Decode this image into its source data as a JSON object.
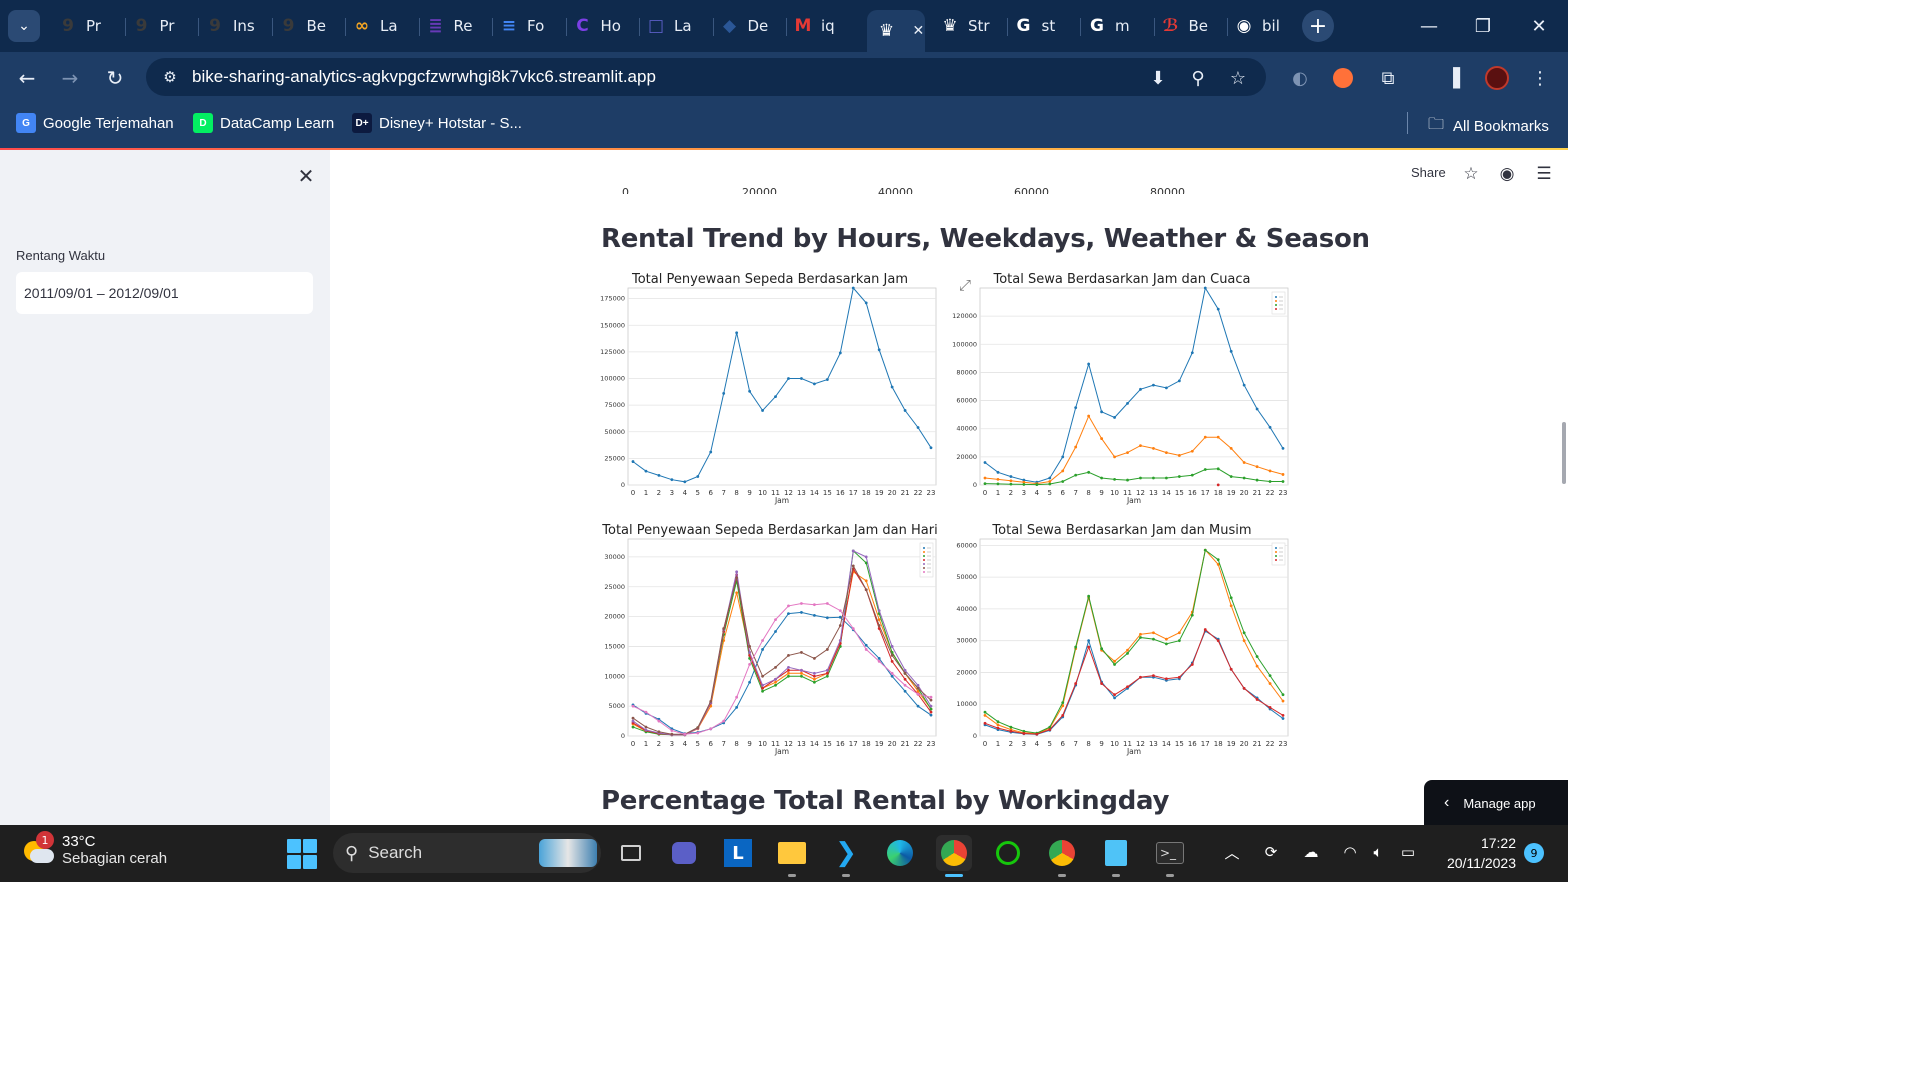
{
  "browser": {
    "tabs": [
      {
        "label": "Pr",
        "color": "#3a3a3a",
        "glyph": "9"
      },
      {
        "label": "Pr",
        "color": "#3a3a3a",
        "glyph": "9"
      },
      {
        "label": "Ins",
        "color": "#3a3a3a",
        "glyph": "9"
      },
      {
        "label": "Be",
        "color": "#3a3a3a",
        "glyph": "9"
      },
      {
        "label": "La",
        "color": "#f5a623",
        "glyph": "∞"
      },
      {
        "label": "Re",
        "color": "#673ab7",
        "glyph": "≣"
      },
      {
        "label": "Fo",
        "color": "#4285f4",
        "glyph": "≡"
      },
      {
        "label": "Ho",
        "color": "#7b3fe4",
        "glyph": "C"
      },
      {
        "label": "La",
        "color": "#5b5fc7",
        "glyph": "□"
      },
      {
        "label": "De",
        "color": "#2b5797",
        "glyph": "◆"
      },
      {
        "label": "iq",
        "color": "#e53935",
        "glyph": "M"
      },
      {
        "label": "",
        "color": "#ffffff",
        "glyph": "♛"
      },
      {
        "label": "Str",
        "color": "#ffffff",
        "glyph": "♛"
      },
      {
        "label": "st",
        "color": "#ffffff",
        "glyph": "G"
      },
      {
        "label": "m",
        "color": "#ffffff",
        "glyph": "G"
      },
      {
        "label": "Be",
        "color": "#e53935",
        "glyph": "ℬ"
      },
      {
        "label": "bil",
        "color": "#ffffff",
        "glyph": "◉"
      }
    ],
    "url": "bike-sharing-analytics-agkvpgcfzwrwhgi8k7vkc6.streamlit.app",
    "bookmarks": [
      {
        "label": "Google Terjemahan",
        "color": "#4285f4",
        "glyph": "G"
      },
      {
        "label": "DataCamp Learn",
        "color": "#03ef62",
        "glyph": "D"
      },
      {
        "label": "Disney+ Hotstar - S...",
        "color": "#0c1a3f",
        "glyph": "D+"
      }
    ],
    "all_bookmarks": "All Bookmarks"
  },
  "sidebar": {
    "range_label": "Rentang Waktu",
    "range_value": "2011/09/01 – 2012/09/01"
  },
  "header": {
    "share": "Share"
  },
  "prev_chart_ticks": [
    "0",
    "20000",
    "40000",
    "60000",
    "80000"
  ],
  "sections": {
    "trend_title": "Rental Trend by Hours, Weekdays, Weather & Season",
    "next_title": "Percentage Total Rental by Workingday"
  },
  "manage_app": "Manage app",
  "taskbar": {
    "temperature": "33°C",
    "weather": "Sebagian cerah",
    "weather_badge": "1",
    "search": "Search",
    "time": "17:22",
    "date": "20/11/2023",
    "notifications": "9"
  },
  "charts": {
    "hour": {
      "title": "Total Penyewaan Sepeda Berdasarkan Jam",
      "xlabel": "Jam"
    },
    "weather": {
      "title": "Total Sewa Berdasarkan Jam dan Cuaca",
      "xlabel": "Jam"
    },
    "weekday": {
      "title": "Total Penyewaan Sepeda Berdasarkan Jam dan Hari",
      "xlabel": "Jam"
    },
    "season": {
      "title": "Total Sewa Berdasarkan Jam dan Musim",
      "xlabel": "Jam"
    }
  },
  "chart_data": [
    {
      "id": "hour",
      "type": "line",
      "title": "Total Penyewaan Sepeda Berdasarkan Jam",
      "xlabel": "Jam",
      "ylabel": "",
      "x": [
        0,
        1,
        2,
        3,
        4,
        5,
        6,
        7,
        8,
        9,
        10,
        11,
        12,
        13,
        14,
        15,
        16,
        17,
        18,
        19,
        20,
        21,
        22,
        23
      ],
      "ylim": [
        0,
        185000
      ],
      "yticks": [
        0,
        25000,
        50000,
        75000,
        100000,
        125000,
        150000,
        175000
      ],
      "grid": true,
      "series": [
        {
          "color": "#1f77b4",
          "values": [
            22000,
            13000,
            9000,
            5000,
            3000,
            8000,
            31000,
            86000,
            143000,
            88000,
            70000,
            83000,
            100000,
            100000,
            95000,
            99000,
            124000,
            185000,
            171000,
            127000,
            92000,
            70000,
            54000,
            35000
          ]
        }
      ]
    },
    {
      "id": "weather",
      "type": "line",
      "title": "Total Sewa Berdasarkan Jam dan Cuaca",
      "xlabel": "Jam",
      "ylabel": "",
      "x": [
        0,
        1,
        2,
        3,
        4,
        5,
        6,
        7,
        8,
        9,
        10,
        11,
        12,
        13,
        14,
        15,
        16,
        17,
        18,
        19,
        20,
        21,
        22,
        23
      ],
      "ylim": [
        0,
        140000
      ],
      "yticks": [
        0,
        20000,
        40000,
        60000,
        80000,
        100000,
        120000
      ],
      "grid": true,
      "legend": "top-right",
      "series": [
        {
          "color": "#1f77b4",
          "values": [
            16000,
            9000,
            6000,
            3500,
            2000,
            5000,
            20000,
            55000,
            86000,
            52000,
            48000,
            58000,
            68000,
            71000,
            69000,
            74000,
            94000,
            140000,
            125000,
            95000,
            71000,
            54000,
            41000,
            26000
          ]
        },
        {
          "color": "#ff7f0e",
          "values": [
            5000,
            4000,
            3000,
            2000,
            1000,
            2500,
            10000,
            27000,
            49000,
            33000,
            20000,
            23000,
            28000,
            26000,
            23000,
            21000,
            24000,
            34000,
            34000,
            26000,
            16000,
            13000,
            10000,
            7500
          ]
        },
        {
          "color": "#2ca02c",
          "values": [
            1000,
            800,
            600,
            400,
            300,
            700,
            2500,
            7000,
            9000,
            5000,
            4000,
            3500,
            5000,
            5000,
            5000,
            6000,
            7000,
            11000,
            11500,
            6000,
            5000,
            3500,
            2500,
            2500
          ]
        },
        {
          "color": "#d62728",
          "values": [
            null,
            null,
            null,
            null,
            null,
            null,
            null,
            null,
            null,
            null,
            null,
            null,
            null,
            null,
            null,
            null,
            null,
            null,
            100,
            null,
            null,
            null,
            null,
            null
          ]
        }
      ]
    },
    {
      "id": "weekday",
      "type": "line",
      "title": "Total Penyewaan Sepeda Berdasarkan Jam dan Hari",
      "xlabel": "Jam",
      "ylabel": "",
      "x": [
        0,
        1,
        2,
        3,
        4,
        5,
        6,
        7,
        8,
        9,
        10,
        11,
        12,
        13,
        14,
        15,
        16,
        17,
        18,
        19,
        20,
        21,
        22,
        23
      ],
      "ylim": [
        0,
        33000
      ],
      "yticks": [
        0,
        5000,
        10000,
        15000,
        20000,
        25000,
        30000
      ],
      "grid": true,
      "legend": "top-right",
      "series": [
        {
          "color": "#1f77b4",
          "values": [
            5200,
            3800,
            2800,
            1200,
            400,
            600,
            1200,
            2200,
            4800,
            9000,
            14500,
            17500,
            20500,
            20700,
            20200,
            19800,
            19900,
            17800,
            15200,
            13000,
            10000,
            7500,
            5000,
            3500
          ]
        },
        {
          "color": "#ff7f0e",
          "values": [
            2000,
            800,
            400,
            200,
            200,
            1200,
            5000,
            16000,
            24000,
            14000,
            8000,
            9000,
            10500,
            10500,
            9500,
            10500,
            16000,
            27500,
            26000,
            19500,
            14000,
            10500,
            7500,
            4500
          ]
        },
        {
          "color": "#2ca02c",
          "values": [
            1500,
            700,
            300,
            200,
            200,
            1400,
            5500,
            17000,
            26000,
            13000,
            7500,
            8500,
            10000,
            10000,
            9000,
            10000,
            15000,
            31000,
            29000,
            20500,
            14000,
            10500,
            8000,
            4500
          ]
        },
        {
          "color": "#d62728",
          "values": [
            2200,
            900,
            400,
            200,
            200,
            1300,
            5500,
            17500,
            27000,
            13500,
            8000,
            9500,
            11000,
            11000,
            10000,
            10500,
            15500,
            28000,
            24500,
            18000,
            12500,
            9500,
            7000,
            4000
          ]
        },
        {
          "color": "#9467bd",
          "values": [
            2500,
            1000,
            500,
            200,
            200,
            1300,
            5600,
            17800,
            27500,
            14000,
            8500,
            9500,
            11500,
            11000,
            10500,
            11000,
            16000,
            31000,
            30000,
            21000,
            15000,
            11000,
            8500,
            5000
          ]
        },
        {
          "color": "#8c564b",
          "values": [
            3000,
            1500,
            700,
            300,
            300,
            1400,
            5800,
            18000,
            26500,
            15000,
            10000,
            11500,
            13500,
            14000,
            13000,
            14500,
            18500,
            28500,
            24500,
            18500,
            13500,
            10500,
            8000,
            6000
          ]
        },
        {
          "color": "#e377c2",
          "values": [
            5000,
            4000,
            2500,
            900,
            300,
            500,
            1200,
            2500,
            6500,
            12000,
            16000,
            19500,
            21800,
            22200,
            22000,
            22200,
            21000,
            18000,
            14500,
            12500,
            10500,
            8500,
            7000,
            6500
          ]
        }
      ]
    },
    {
      "id": "season",
      "type": "line",
      "title": "Total Sewa Berdasarkan Jam dan Musim",
      "xlabel": "Jam",
      "ylabel": "",
      "x": [
        0,
        1,
        2,
        3,
        4,
        5,
        6,
        7,
        8,
        9,
        10,
        11,
        12,
        13,
        14,
        15,
        16,
        17,
        18,
        19,
        20,
        21,
        22,
        23
      ],
      "ylim": [
        0,
        62000
      ],
      "yticks": [
        0,
        10000,
        20000,
        30000,
        40000,
        50000,
        60000
      ],
      "grid": true,
      "legend": "top-right",
      "series": [
        {
          "color": "#1f77b4",
          "values": [
            3500,
            2000,
            1200,
            700,
            500,
            1800,
            6000,
            16000,
            30000,
            17000,
            12000,
            15000,
            18500,
            18500,
            17500,
            18000,
            23000,
            33000,
            30500,
            21000,
            15000,
            12000,
            8500,
            5500
          ]
        },
        {
          "color": "#ff7f0e",
          "values": [
            6500,
            3500,
            2000,
            1000,
            700,
            2500,
            9500,
            27500,
            43500,
            27000,
            23500,
            27000,
            32000,
            32500,
            30500,
            32500,
            39000,
            58500,
            54000,
            41000,
            30000,
            22000,
            16500,
            11000
          ]
        },
        {
          "color": "#2ca02c",
          "values": [
            7500,
            4500,
            2800,
            1500,
            900,
            2800,
            10500,
            28000,
            44000,
            27500,
            22500,
            26000,
            31000,
            30500,
            29000,
            30000,
            38000,
            58500,
            55500,
            43500,
            32500,
            25000,
            19000,
            13000
          ]
        },
        {
          "color": "#d62728",
          "values": [
            4000,
            2500,
            1500,
            800,
            600,
            2000,
            6500,
            16500,
            28000,
            16500,
            13000,
            15500,
            18500,
            19000,
            18000,
            18500,
            22500,
            33500,
            30000,
            21000,
            15000,
            11500,
            9000,
            6500
          ]
        }
      ]
    }
  ]
}
